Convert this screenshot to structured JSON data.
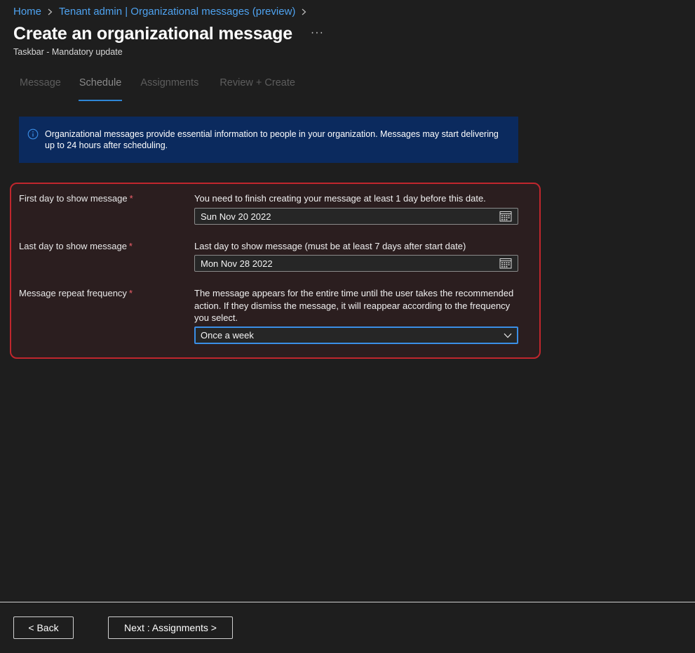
{
  "breadcrumb": {
    "items": [
      {
        "label": "Home"
      },
      {
        "label": "Tenant admin | Organizational messages (preview)"
      }
    ]
  },
  "header": {
    "title": "Create an organizational message",
    "more_label": "···",
    "subtitle": "Taskbar - Mandatory update"
  },
  "tabs": [
    {
      "label": "Message",
      "active": false
    },
    {
      "label": "Schedule",
      "active": true
    },
    {
      "label": "Assignments",
      "active": false
    },
    {
      "label": "Review + Create",
      "active": false
    }
  ],
  "info_banner": {
    "icon": "info-icon",
    "text": "Organizational messages provide essential information to people in your organization. Messages may start delivering up to 24 hours after scheduling."
  },
  "schedule": {
    "required_marker": "*",
    "first_day": {
      "label": "First day to show message",
      "help": "You need to finish creating your message at least 1 day before this date.",
      "value": "Sun Nov 20 2022",
      "icon": "calendar-icon"
    },
    "last_day": {
      "label": "Last day to show message",
      "help": "Last day to show message (must be at least 7 days after start date)",
      "value": "Mon Nov 28 2022",
      "icon": "calendar-icon"
    },
    "frequency": {
      "label": "Message repeat frequency",
      "help": "The message appears for the entire time until the user takes the recommended action. If they dismiss the message, it will reappear according to the frequency you select.",
      "value": "Once a week",
      "icon": "chevron-down-icon"
    }
  },
  "footer": {
    "back_label": "< Back",
    "next_label": "Next : Assignments >"
  },
  "colors": {
    "background": "#1e1e1e",
    "link": "#4ea2ef",
    "banner": "#0b2a5e",
    "highlight_border": "#c0262d",
    "focus": "#3a8ee6",
    "required": "#f0606a"
  }
}
